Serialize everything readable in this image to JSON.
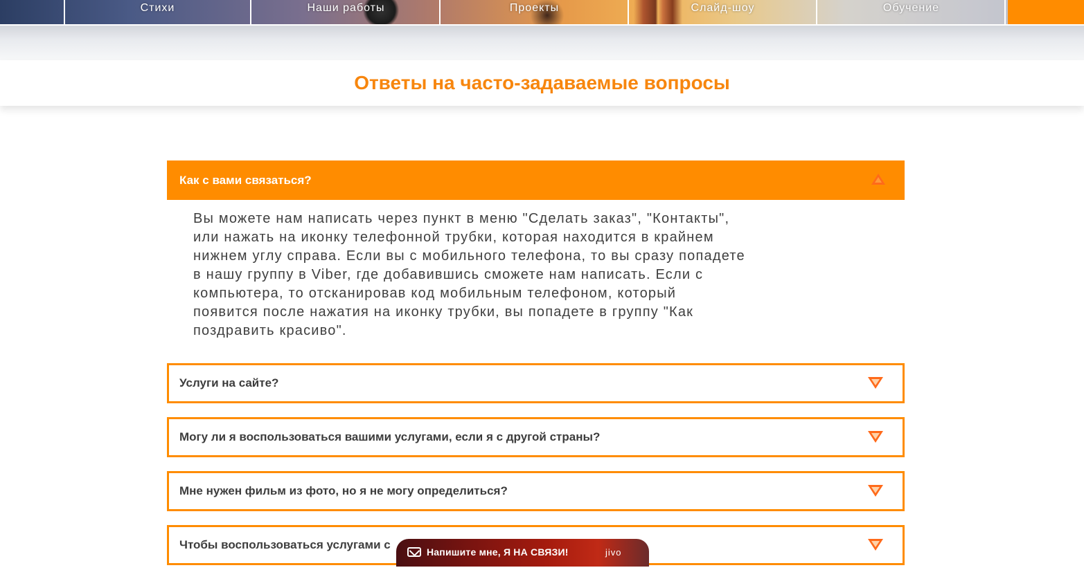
{
  "nav": {
    "items": [
      "Стихи",
      "Наши работы",
      "Проекты",
      "Слайд-шоу",
      "Обучение"
    ]
  },
  "page_title": "Ответы на часто-задаваемые вопросы",
  "faq": {
    "open_item": {
      "question": "Как с вами связаться?",
      "answer": "Вы можете нам написать через пункт в меню \"Сделать заказ\", \"Контакты\", или нажать на иконку телефонной трубки, которая находится в крайнем нижнем углу справа. Если вы с мобильного телефона, то вы сразу попадете в нашу группу в Viber, где добавившись сможете нам написать. Если с компьютера, то отсканировав код мобильным телефоном, который появится после нажатия на иконку трубки, вы попадете в группу \"Как поздравить красиво\"."
    },
    "items": [
      "Услуги на сайте?",
      "Могу ли я воспользоваться вашими услугами, если я с другой страны?",
      "Мне нужен фильм из фото, но я не могу определиться?",
      "Чтобы воспользоваться услугами с"
    ]
  },
  "chat": {
    "label": "Напишите мне, Я НА СВЯЗИ!",
    "brand": "jivo"
  },
  "colors": {
    "accent": "#ff8c00",
    "title": "#f7860e",
    "text": "#3f3f3f"
  },
  "icons": {
    "expanded": "triangle-up-icon",
    "collapsed": "triangle-down-icon",
    "chat": "envelope-icon"
  }
}
